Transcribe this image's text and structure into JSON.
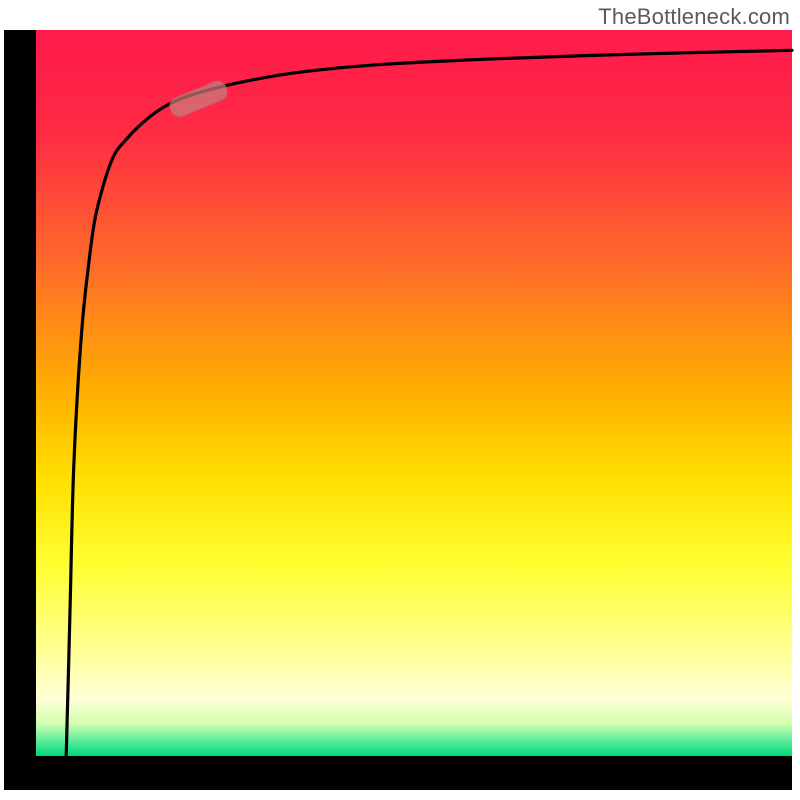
{
  "attribution": "TheBottleneck.com",
  "colors": {
    "gradient_top": "#ff1a4b",
    "gradient_mid_upper": "#ff6a2a",
    "gradient_mid": "#ffd400",
    "gradient_lower": "#ffff66",
    "gradient_bottom_white": "#ffffe0",
    "gradient_bottom": "#00e078",
    "axis": "#000000",
    "curve": "#000000",
    "marker": "#c77b7b",
    "marker_stroke": "#a85f5f"
  },
  "chart_data": {
    "type": "line",
    "title": "",
    "xlabel": "",
    "ylabel": "",
    "ylim": [
      0,
      100
    ],
    "xlim": [
      0,
      100
    ],
    "series": [
      {
        "name": "bottleneck-curve",
        "note": "Curve starts near (≈4, 0), rises steeply along the left edge, then asymptotically approaches the top. Values estimated from pixel positions.",
        "x": [
          4,
          4.5,
          5,
          6,
          7,
          8,
          10,
          12,
          15,
          18,
          22,
          28,
          35,
          45,
          60,
          80,
          100
        ],
        "y": [
          0,
          20,
          40,
          58,
          68,
          75,
          82,
          85,
          88,
          90,
          91.5,
          93,
          94.2,
          95.2,
          96,
          96.7,
          97.2
        ]
      }
    ],
    "marker": {
      "name": "highlight-segment",
      "approx_x_range": [
        18,
        25
      ],
      "approx_y_range": [
        89,
        92
      ],
      "shape": "rounded-pill"
    }
  }
}
